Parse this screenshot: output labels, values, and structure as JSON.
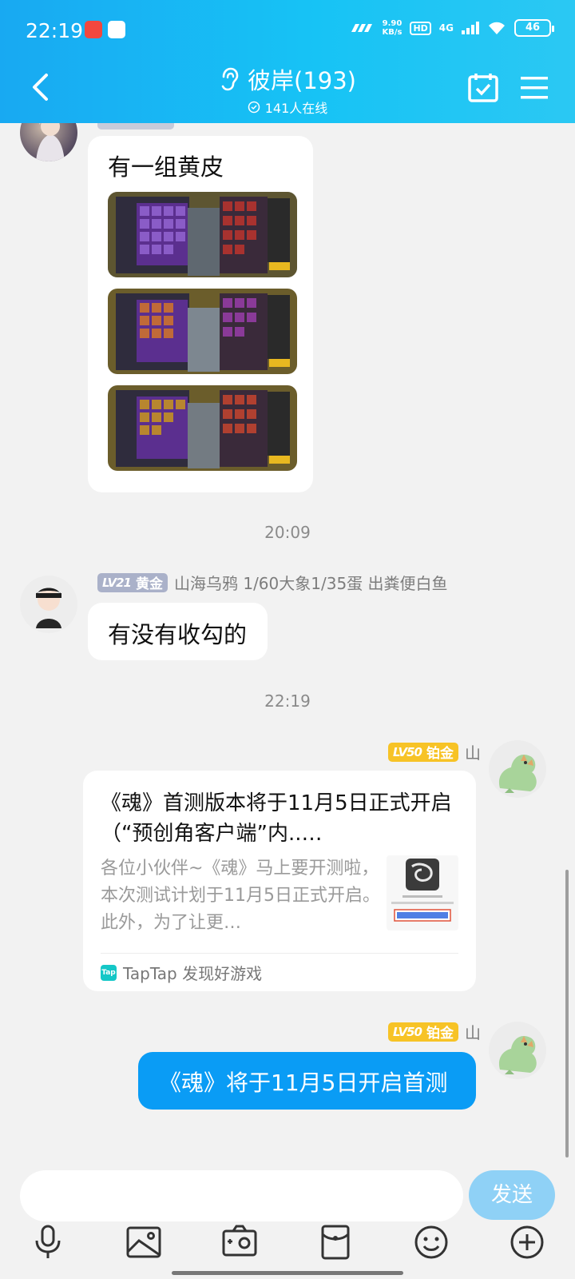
{
  "status_bar": {
    "time": "22:19",
    "speed_top": "9.90",
    "speed_unit": "KB/s",
    "hd": "HD",
    "network": "4G",
    "battery": "46"
  },
  "header": {
    "title": "彼岸(193)",
    "online": "141人在线"
  },
  "messages": {
    "m1": {
      "text": "有一组黄皮"
    },
    "time1": "20:09",
    "m2": {
      "level": "LV21",
      "rank": "黄金",
      "nickname": "山海乌鸦  1/60大象1/35蛋  出粪便白鱼",
      "text": "有没有收勾的"
    },
    "time2": "22:19",
    "m3": {
      "level": "LV50",
      "rank": "铂金",
      "nickname": "山",
      "card_title": "《魂》首测版本将于11月5日正式开启（“预创角客户端”内..…",
      "card_desc": "各位小伙伴~《魂》马上要开测啦，本次测试计划于11月5日正式开启。此外，为了让更…",
      "card_source": "TapTap 发现好游戏",
      "tap_logo": "Tap"
    },
    "m4": {
      "level": "LV50",
      "rank": "铂金",
      "nickname": "山",
      "text": "《魂》将于11月5日开启首测"
    }
  },
  "input": {
    "placeholder": "",
    "send_label": "发送"
  },
  "colors": {
    "header_gradient_start": "#18a9f2",
    "header_gradient_end": "#2bc8f3",
    "outgoing_bubble": "#0a9cf5",
    "send_button": "#8fd1f6",
    "badge_gold": "#aab1c9",
    "badge_platinum": "#f7c326"
  },
  "icons": [
    "back-arrow-icon",
    "ear-icon",
    "online-check-icon",
    "calendar-check-icon",
    "menu-icon",
    "microphone-icon",
    "image-icon",
    "camera-icon",
    "red-packet-icon",
    "emoji-icon",
    "plus-icon"
  ]
}
